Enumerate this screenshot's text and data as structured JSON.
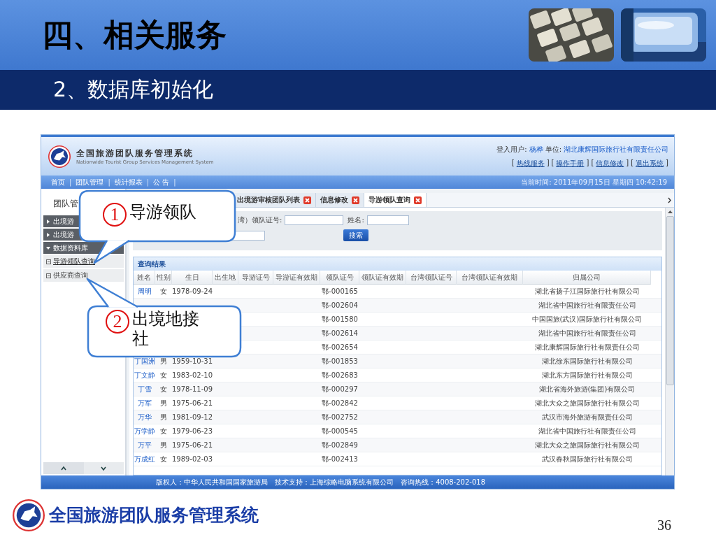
{
  "slide": {
    "title": "四、相关服务",
    "subtitle": "2、数据库初始化",
    "brand": "全国旅游团队服务管理系统",
    "page_number": "36"
  },
  "app": {
    "title": "全国旅游团队服务管理系统",
    "subtitle": "Nationwide Tourist Group Services Management System",
    "user_label": "登入用户:",
    "user": "杨桦",
    "unit_label": "单位:",
    "unit": "湖北康辉国际旅行社有限责任公司",
    "links": [
      {
        "before": "[",
        "label": "热线服务",
        "after": "]"
      },
      {
        "before": "[",
        "label": "操作手册",
        "after": "]"
      },
      {
        "before": "[",
        "label": "信息修改",
        "after": "]"
      },
      {
        "before": "[",
        "label": "退出系统",
        "after": "]"
      }
    ],
    "nav": [
      {
        "label": "首页",
        "separator": "|"
      },
      {
        "label": "团队管理",
        "separator": "|"
      },
      {
        "label": "统计报表",
        "separator": "|"
      },
      {
        "label": "公 告",
        "separator": "|"
      }
    ],
    "time": "当前时间: 2011年09月15日 星期四 10:42:19",
    "sidebar": {
      "heading": "团队管",
      "groups": [
        {
          "label": "出境游",
          "expanded": false
        },
        {
          "label": "出境游",
          "expanded": false
        },
        {
          "label": "数据资料库",
          "expanded": true,
          "children": [
            {
              "label": "导游领队查询",
              "selected": true
            },
            {
              "label": "供应商查询",
              "selected": false
            }
          ]
        }
      ]
    },
    "tabs": [
      {
        "label": "出境游审核团队列表",
        "selected": false
      },
      {
        "label": "信息修改",
        "selected": false
      },
      {
        "label": "导游领队查询",
        "selected": true
      }
    ],
    "search": {
      "fields": [
        {
          "label": "湾）领队证号:"
        },
        {
          "label": "姓名:"
        }
      ],
      "button": "搜索"
    },
    "results": {
      "title": "查询结果",
      "columns": [
        "姓名",
        "性别",
        "生日",
        "出生地",
        "导游证号",
        "导游证有效期",
        "领队证号",
        "领队证有效期",
        "台湾领队证号",
        "台湾领队证有效期",
        "归属公司"
      ],
      "rows": [
        {
          "name": "周明",
          "sex": "女",
          "birth": "1978-09-24",
          "leader_no": "鄂-000165",
          "company": "湖北省扬子江国际旅行社有限公司"
        },
        {
          "leader_no": "鄂-002604",
          "company": "湖北省中国旅行社有限责任公司"
        },
        {
          "leader_no": "鄂-001580",
          "company": "中国国旅(武汉)国际旅行社有限公司"
        },
        {
          "leader_no": "鄂-002614",
          "company": "湖北省中国旅行社有限责任公司"
        },
        {
          "leader_no": "鄂-002654",
          "company": "湖北康辉国际旅行社有限责任公司"
        },
        {
          "name": "丁国洲",
          "sex": "男",
          "birth": "1959-10-31",
          "leader_no": "鄂-001853",
          "company": "湖北徐东国际旅行社有限公司"
        },
        {
          "name": "丁文静",
          "sex": "女",
          "birth": "1983-02-10",
          "leader_no": "鄂-002683",
          "company": "湖北东方国际旅行社有限公司"
        },
        {
          "name": "丁雪",
          "sex": "女",
          "birth": "1978-11-09",
          "leader_no": "鄂-000297",
          "company": "湖北省海外旅游(集团)有限公司"
        },
        {
          "name": "万军",
          "sex": "男",
          "birth": "1975-06-21",
          "leader_no": "鄂-002842",
          "company": "湖北大众之旅国际旅行社有限公司"
        },
        {
          "name": "万华",
          "sex": "男",
          "birth": "1981-09-12",
          "leader_no": "鄂-002752",
          "company": "武汉市海外旅游有限责任公司"
        },
        {
          "name": "万学静",
          "sex": "女",
          "birth": "1979-06-23",
          "leader_no": "鄂-000545",
          "company": "湖北省中国旅行社有限责任公司"
        },
        {
          "name": "万平",
          "sex": "男",
          "birth": "1975-06-21",
          "leader_no": "鄂-002849",
          "company": "湖北大众之旅国际旅行社有限公司"
        },
        {
          "name": "万成红",
          "sex": "女",
          "birth": "1989-02-03",
          "leader_no": "鄂-002413",
          "company": "武汉春秋国际旅行社有限公司"
        }
      ]
    },
    "footer": [
      "版权人：中华人民共和国国家旅游局",
      "技术支持：上海综略电脑系统有限公司",
      "咨询热线：4008-202-018"
    ]
  },
  "callouts": [
    {
      "number": "1",
      "text": "导游领队"
    },
    {
      "number": "2",
      "text": "出境地接社"
    }
  ]
}
